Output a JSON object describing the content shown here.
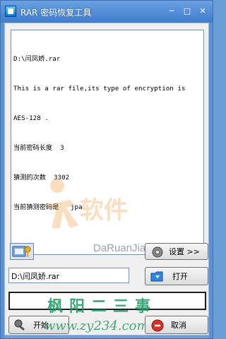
{
  "window": {
    "title": "RAR 密码恢复工具",
    "min_glyph": "─",
    "max_glyph": "□",
    "close_glyph": "✕"
  },
  "log": {
    "lines": [
      "D:\\闫凤娇.rar",
      "This is a rar file,its type of encryption is",
      "AES-128 .",
      "当前密码长度  3",
      "猜测的次数  3302",
      "当前猜测密码是   jpa"
    ]
  },
  "watermark": {
    "brand": "大软件",
    "site": "DaRuanJian.com"
  },
  "buttons": {
    "settings": "设置 >>",
    "open": "打开",
    "start": "开始",
    "cancel": "取消"
  },
  "path_input": {
    "value": "D:\\闫凤娇.rar"
  },
  "overlay": {
    "promo": "枫阳二三事",
    "url": "www.zy234.com"
  },
  "colors": {
    "titlebar": "#3f7ccc",
    "promo": "#1c9a63"
  },
  "icons": [
    "app-icon",
    "minimize-icon",
    "maximize-icon",
    "close-icon",
    "key-icon",
    "gear-icon",
    "folder-icon",
    "start-icon",
    "cancel-icon"
  ]
}
